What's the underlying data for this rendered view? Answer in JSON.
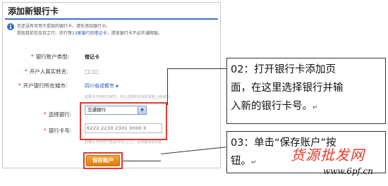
{
  "panel": {
    "title": "添加新银行卡",
    "notice_line1": "您还没有可用于提现的银行卡，请先添加银行卡。",
    "notice_line2_a": "提现目前仅支持工行、农行等",
    "notice_line2_link1": "13家银行",
    "notice_line2_b": "的",
    "notice_line2_link2": "借记卡",
    "notice_line2_c": "，提现银行卡不必开通网银。"
  },
  "form": {
    "account_type_label": "银行账户类型:",
    "account_type_value": "借记卡",
    "holder_name_label": "开户人真实姓名:",
    "holder_name_value": "□□□",
    "city_label": "开户银行所在城市:",
    "city_value": "四川省成都市",
    "city_hint": "如果找不到所在城市，可以选择所在地区或者上级城市。",
    "bank_label": "选择银行:",
    "bank_value": "交通银行",
    "card_label": "银行卡号:",
    "card_value": "6222 2230 2301 0000 0",
    "card_hint": "此银行卡的开户名必须为□□□，否则提现会失败。",
    "save_label": "保存账户"
  },
  "callouts": {
    "step2": [
      "02：打开银行卡添加页",
      "面，在这里选择银行并输",
      "入新的银行卡号。"
    ],
    "step3": [
      "03：单击“保存账户”按",
      "钮。"
    ],
    "return_mark": "↵"
  },
  "watermark": {
    "text": "货源批发网",
    "url": "www.6pf.cn"
  },
  "colors": {
    "accent_blue": "#3d73c9",
    "link_blue": "#2456b3",
    "highlight_red": "#e2382d",
    "button_orange": "#e07a0a"
  },
  "icons": {
    "info": "info-icon",
    "dropdown": "chevron-down-icon"
  }
}
